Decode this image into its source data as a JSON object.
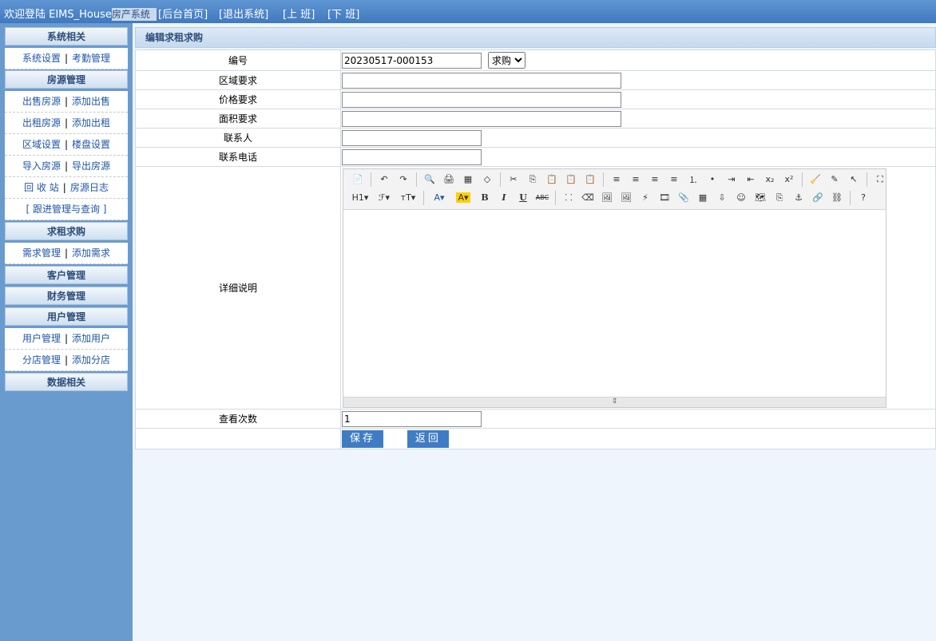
{
  "topbar": {
    "welcome": "欢迎登陆 EIMS_House",
    "system_name": "房产系统",
    "links": [
      "[后台首页]",
      "[退出系统]",
      "[上 班]",
      "[下 班]"
    ]
  },
  "sidebar": {
    "system": {
      "title": "系统相关",
      "items": [
        [
          "系统设置",
          "考勤管理"
        ]
      ]
    },
    "property": {
      "title": "房源管理",
      "items": [
        [
          "出售房源",
          "添加出售"
        ],
        [
          "出租房源",
          "添加出租"
        ],
        [
          "区域设置",
          "楼盘设置"
        ],
        [
          "导入房源",
          "导出房源"
        ],
        [
          "回 收 站",
          "房源日志"
        ]
      ],
      "followup": "[ 跟进管理与查询 ]"
    },
    "rent_buy": {
      "title": "求租求购",
      "items": [
        [
          "需求管理",
          "添加需求"
        ]
      ]
    },
    "customer": {
      "title": "客户管理"
    },
    "finance": {
      "title": "财务管理"
    },
    "users": {
      "title": "用户管理",
      "items": [
        [
          "用户管理",
          "添加用户"
        ],
        [
          "分店管理",
          "添加分店"
        ]
      ]
    },
    "data": {
      "title": "数据相关"
    },
    "separator": "|"
  },
  "main": {
    "title": "编辑求租求购",
    "fields": {
      "number": {
        "label": "编号",
        "value": "20230517-000153"
      },
      "type": {
        "selected": "求购",
        "options": [
          "求购"
        ]
      },
      "area": {
        "label": "区域要求",
        "value": ""
      },
      "price": {
        "label": "价格要求",
        "value": ""
      },
      "size": {
        "label": "面积要求",
        "value": ""
      },
      "contact": {
        "label": "联系人",
        "value": ""
      },
      "phone": {
        "label": "联系电话",
        "value": ""
      },
      "detail": {
        "label": "详细说明"
      },
      "views": {
        "label": "查看次数",
        "value": "1"
      }
    },
    "buttons": {
      "save": "保存",
      "back": "返回"
    }
  },
  "editor": {
    "row1": [
      "source-icon",
      "undo-icon",
      "redo-icon",
      "preview-icon",
      "print-icon",
      "template-icon",
      "code-icon",
      "cut-icon",
      "copy-icon",
      "paste-icon",
      "paste-text-icon",
      "paste-word-icon",
      "align-left-icon",
      "align-center-icon",
      "align-right-icon",
      "justify-icon",
      "ordered-list-icon",
      "unordered-list-icon",
      "indent-icon",
      "outdent-icon",
      "subscript-icon",
      "superscript-icon",
      "clear-format-icon",
      "select-all-icon",
      "pointer-icon",
      "fullscreen-icon"
    ],
    "row1_glyphs": [
      "📄",
      "↶",
      "↷",
      "🔍",
      "🖨",
      "▦",
      "◇",
      "✂",
      "⎘",
      "📋",
      "📋",
      "📋",
      "≡",
      "≡",
      "≡",
      "≡",
      "⒈",
      "•",
      "⇥",
      "⇤",
      "x₂",
      "x²",
      "🧹",
      "✎",
      "↖",
      "⛶"
    ],
    "row1_sep_after": [
      0,
      2,
      6,
      11,
      21,
      24
    ],
    "row2_labels": {
      "heading": "H1▾",
      "font": "ℱ▾",
      "size": "тT▾",
      "forecolor": "A▾",
      "backcolor": "A▾",
      "bold": "B",
      "italic": "I",
      "underline": "U",
      "strike": "ABC"
    },
    "row2_icons": [
      "hr-icon",
      "eraser-icon",
      "image-icon",
      "multi-image-icon",
      "flash-icon",
      "media-icon",
      "attachment-icon",
      "table-icon",
      "insert-icon",
      "emoticon-icon",
      "map-icon",
      "pagebreak-icon",
      "anchor-icon",
      "link-icon",
      "unlink-icon",
      "help-icon"
    ],
    "row2_glyphs": [
      "⸬",
      "⌫",
      "🖼",
      "🖼",
      "⚡",
      "🎞",
      "📎",
      "▦",
      "⇩",
      "☺",
      "🗺",
      "⎘",
      "⚓",
      "🔗",
      "⛓",
      "?"
    ],
    "colors": {
      "forecolor": "#1f56a8",
      "backcolor_bg": "#ffd200"
    }
  }
}
